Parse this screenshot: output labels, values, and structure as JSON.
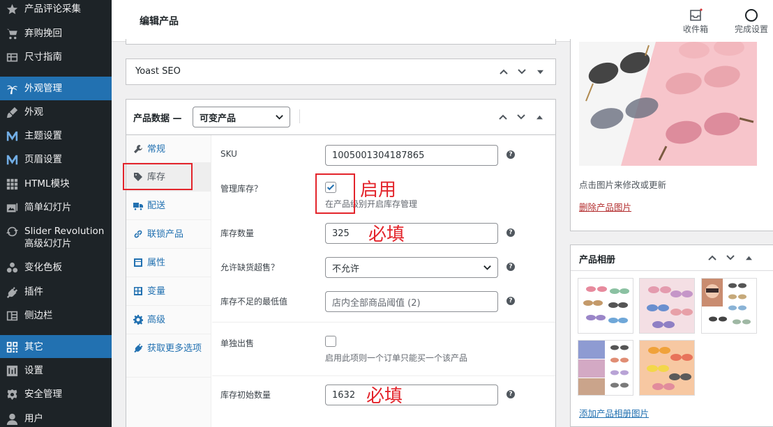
{
  "sidebar": {
    "items": [
      {
        "label": "产品评论采集",
        "icon": "star-icon"
      },
      {
        "label": "弃购挽回",
        "icon": "cart-icon"
      },
      {
        "label": "尺寸指南",
        "icon": "table-icon"
      },
      {
        "label": "外观管理",
        "icon": "palm-icon",
        "active": true
      },
      {
        "label": "外观",
        "icon": "brush-icon"
      },
      {
        "label": "主题设置",
        "icon": "m-logo-icon"
      },
      {
        "label": "页眉设置",
        "icon": "m-logo-icon"
      },
      {
        "label": "HTML模块",
        "icon": "grid-icon"
      },
      {
        "label": "简单幻灯片",
        "icon": "slides-icon"
      },
      {
        "label": "Slider Revolution 高级幻灯片",
        "icon": "refresh-icon"
      },
      {
        "label": "变化色板",
        "icon": "swatches-icon"
      },
      {
        "label": "插件",
        "icon": "plugin-icon"
      },
      {
        "label": "侧边栏",
        "icon": "sidebar-icon"
      },
      {
        "label": "其它",
        "icon": "qr-icon",
        "active": true
      },
      {
        "label": "设置",
        "icon": "settings-icon"
      },
      {
        "label": "安全管理",
        "icon": "shield-icon"
      },
      {
        "label": "用户",
        "icon": "user-icon"
      }
    ]
  },
  "header": {
    "title": "编辑产品",
    "inbox_label": "收件箱",
    "complete_label": "完成设置"
  },
  "yoast": {
    "title": "Yoast SEO"
  },
  "product_data": {
    "title": "产品数据 —",
    "type_selected": "可变产品",
    "tabs": [
      {
        "label": "常规",
        "icon": "wrench-icon"
      },
      {
        "label": "库存",
        "icon": "tag-icon",
        "active": true
      },
      {
        "label": "配送",
        "icon": "truck-icon"
      },
      {
        "label": "联锁产品",
        "icon": "link-icon"
      },
      {
        "label": "属性",
        "icon": "list-icon"
      },
      {
        "label": "变量",
        "icon": "grid-icon"
      },
      {
        "label": "高级",
        "icon": "gear-icon"
      },
      {
        "label": "获取更多选项",
        "icon": "plugin-icon"
      }
    ],
    "fields": {
      "sku_label": "SKU",
      "sku_value": "1005001304187865",
      "manage_stock_label": "管理库存？",
      "manage_stock_desc": "在产品级别开启库存管理",
      "stock_qty_label": "库存数量",
      "stock_qty_value": "325",
      "backorders_label": "允许缺货超售？",
      "backorders_value": "不允许",
      "low_stock_label": "库存不足的最低值",
      "low_stock_placeholder": "店内全部商品阈值 (2)",
      "sold_individually_label": "单独出售",
      "sold_individually_desc": "启用此项则一个订单只能买一个该产品",
      "initial_stock_label": "库存初始数量",
      "initial_stock_value": "1632"
    }
  },
  "annotations": {
    "enable": "启用",
    "required1": "必填",
    "required2": "必填"
  },
  "product_image": {
    "hint": "点击图片来修改或更新",
    "remove_link": "删除产品图片"
  },
  "gallery": {
    "title": "产品相册",
    "add_link": "添加产品相册图片"
  },
  "colors": {
    "sidebar_bg": "#1d2327",
    "active_blue": "#2271b1",
    "annotation_red": "#e3242b"
  }
}
